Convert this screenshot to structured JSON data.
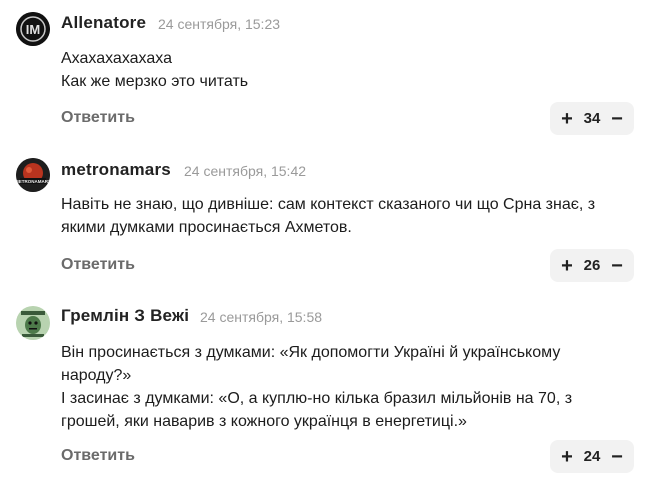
{
  "comments": [
    {
      "author": "Allenatore",
      "date": "24 сентября, 15:23",
      "text": "Ахахахахахаха\nКак же мерзко это читать",
      "reply_label": "Ответить",
      "plus": "+",
      "count": "34",
      "minus": "−",
      "avatar_icon": "inter-milan-logo-icon"
    },
    {
      "author": "metronamars",
      "date": "24 сентября, 15:42",
      "text": "Навіть не знаю, що дивніше: сам контекст сказаного чи що Срна знає, з якими думками просинається Ахметов.",
      "reply_label": "Ответить",
      "plus": "+",
      "count": "26",
      "minus": "−",
      "avatar_icon": "metronamars-logo-icon"
    },
    {
      "author": "Гремлін З Вежі",
      "date": "24 сентября, 15:58",
      "text": "Він просинається з думками: «Як допомогти Україні й українському народу?»\nІ засинає з думками: «О, а куплю-но кілька бразил мільйонів на 70, з грошей, яки наварив з кожного українця в енергетиці.»",
      "reply_label": "Ответить",
      "plus": "+",
      "count": "24",
      "minus": "−",
      "avatar_icon": "gremlin-avatar-icon"
    }
  ]
}
